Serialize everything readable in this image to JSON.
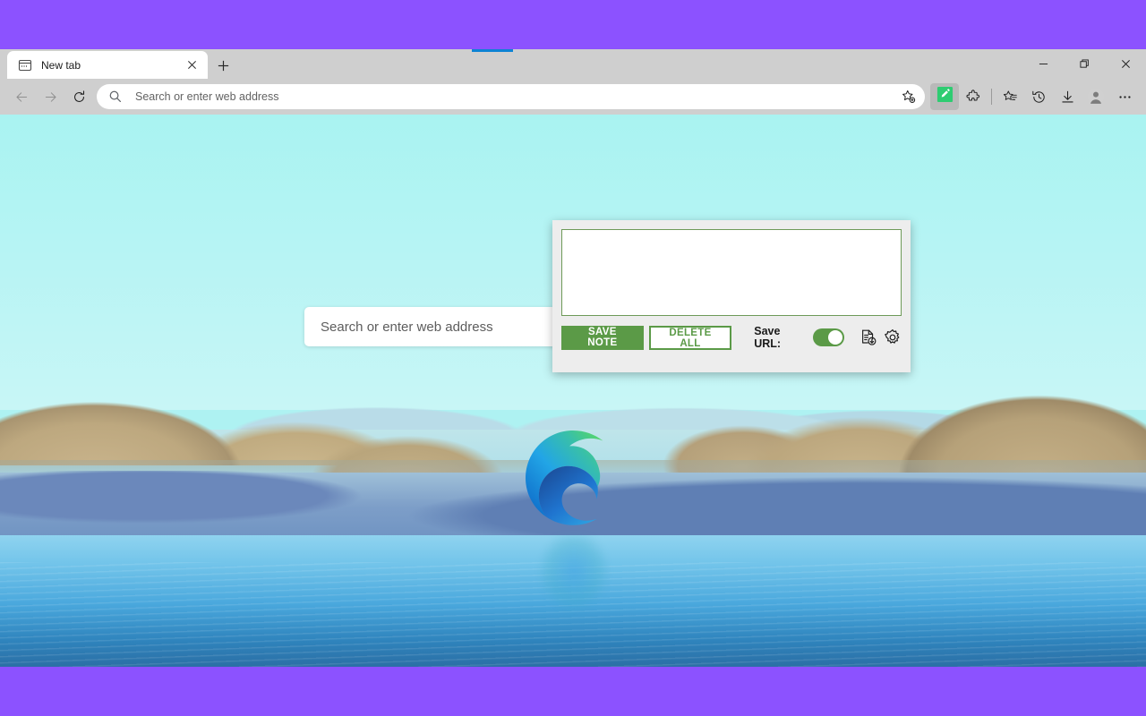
{
  "window": {
    "caption_buttons": [
      {
        "name": "minimize",
        "glyph": "─"
      },
      {
        "name": "maximize",
        "glyph": "❐"
      },
      {
        "name": "close",
        "glyph": "✕"
      }
    ]
  },
  "tabs": {
    "active_tab_title": "New tab",
    "close_tab_glyph": "✕",
    "new_tab_glyph": "+",
    "favicon_name": "new-tab-page-icon"
  },
  "toolbar": {
    "back_label": "Back",
    "forward_label": "Forward",
    "refresh_label": "Refresh",
    "address_value": "",
    "address_placeholder": "Search or enter web address",
    "favorite_label": "Add this page to favorites",
    "extension_label": "Sticky Notes extension",
    "extensions_label": "Extensions",
    "collections_label": "Collections",
    "history_label": "History",
    "downloads_label": "Downloads",
    "profile_label": "Profile",
    "settings_more_glyph": "⋯"
  },
  "newtab": {
    "search_value": "",
    "search_placeholder": "Search or enter web address",
    "logo_name": "microsoft-edge-logo"
  },
  "popup": {
    "note_value": "",
    "note_placeholder": "",
    "save_note_label": "SAVE NOTE",
    "delete_all_label": "DELETE ALL",
    "save_url_label": "Save URL:",
    "save_url_enabled": true,
    "export_icon_name": "export-notes-icon",
    "settings_icon_name": "gear-icon"
  },
  "colors": {
    "accent_purple": "#8c52ff",
    "extension_green": "#5b9a47",
    "textarea_border_green": "#6e9a58",
    "tab_drag_indicator_blue": "#0d82d4",
    "chrome_gray": "#cfcfcf",
    "popup_gray": "#ededed"
  }
}
